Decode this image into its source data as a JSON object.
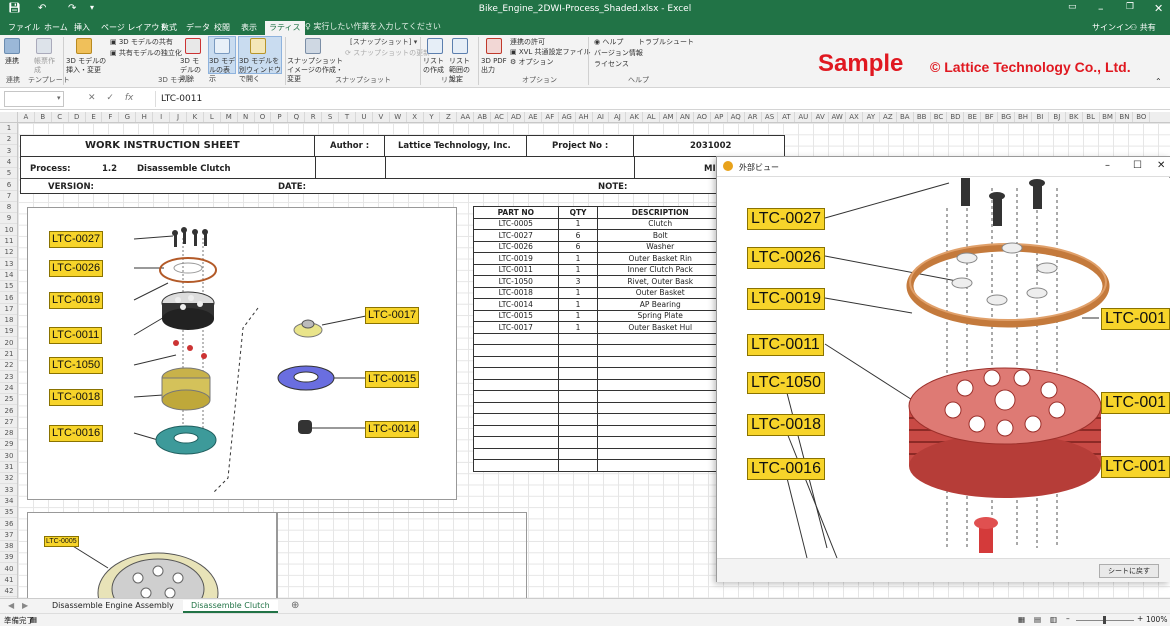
{
  "window": {
    "title": "Bike_Engine_2DWI-Process_Shaded.xlsx - Excel",
    "signin": "サインイン",
    "share": "共有"
  },
  "ribbon_tabs": [
    "ファイル",
    "ホーム",
    "挿入",
    "ページ レイアウト",
    "数式",
    "データ",
    "校閲",
    "表示",
    "ラティス"
  ],
  "tell_me": "実行したい作業を入力してください",
  "ribbon": {
    "g1": {
      "b1": "連携",
      "b2": "帳票作成",
      "label": "連携",
      "label2": "テンプレート"
    },
    "g2": {
      "b1": "3D モデルの挿入・変更",
      "b2": "3D モデルの共有",
      "b3": "共有モデルの独立化",
      "b4": "3D モデルの削除",
      "b5": "3D モデルの表示",
      "b6": "3D モデルを別ウィンドウで開く",
      "label": "3D モデル"
    },
    "g3": {
      "b1": "スナップショットイメージの作成・変更",
      "b2": "[スナップショット]",
      "b3": "スナップショットの更新",
      "label": "スナップショット"
    },
    "g4": {
      "b1": "リストの作成",
      "b2": "リスト範囲の設定",
      "label": "リスト"
    },
    "g5": {
      "b1": "3D PDF 出力",
      "b2": "連携の許可",
      "b3": "XVL 共通設定ファイル",
      "b4": "オプション",
      "label": "オプション"
    },
    "g6": {
      "b1": "ヘルプ",
      "b2": "トラブルシュート",
      "b3": "バージョン情報",
      "b4": "ライセンス",
      "label": "ヘルプ"
    }
  },
  "watermark": {
    "sample": "Sample",
    "copyright": "© Lattice Technology Co., Ltd."
  },
  "formula": {
    "namebox": "",
    "value": "LTC-0011",
    "fx": "fx"
  },
  "columns": [
    "A",
    "B",
    "C",
    "D",
    "E",
    "F",
    "G",
    "H",
    "I",
    "J",
    "K",
    "L",
    "M",
    "N",
    "O",
    "P",
    "Q",
    "R",
    "S",
    "T",
    "U",
    "V",
    "W",
    "X",
    "Y",
    "Z",
    "AA",
    "AB",
    "AC",
    "AD",
    "AE",
    "AF",
    "AG",
    "AH",
    "AI",
    "AJ",
    "AK",
    "AL",
    "AM",
    "AN",
    "AO",
    "AP",
    "AQ",
    "AR",
    "AS",
    "AT",
    "AU",
    "AV",
    "AW",
    "AX",
    "AY",
    "AZ",
    "BA",
    "BB",
    "BC",
    "BD",
    "BE",
    "BF",
    "BG",
    "BH",
    "BI",
    "BJ",
    "BK",
    "BL",
    "BM",
    "BN",
    "BO"
  ],
  "rows": [
    "1",
    "2",
    "3",
    "4",
    "5",
    "6",
    "7",
    "8",
    "9",
    "10",
    "11",
    "12",
    "13",
    "14",
    "15",
    "16",
    "17",
    "18",
    "19",
    "20",
    "21",
    "22",
    "23",
    "24",
    "25",
    "26",
    "27",
    "28",
    "29",
    "30",
    "31",
    "32",
    "33",
    "34",
    "35",
    "36",
    "37",
    "38",
    "39",
    "40",
    "41",
    "42"
  ],
  "form": {
    "title": "WORK INSTRUCTION SHEET",
    "author_label": "Author :",
    "author": "Lattice Technology, Inc.",
    "project_label": "Project No :",
    "project": "2031002",
    "process_label": "Process:",
    "process_no": "1.2",
    "process_name": "Disassemble Clutch",
    "mi": "MI",
    "version_label": "VERSION:",
    "date_label": "DATE:",
    "note_label": "NOTE:"
  },
  "callouts_left": [
    "LTC-0027",
    "LTC-0026",
    "LTC-0019",
    "LTC-0011",
    "LTC-1050",
    "LTC-0018",
    "LTC-0016"
  ],
  "callouts_right": [
    "LTC-0017",
    "LTC-0015",
    "LTC-0014"
  ],
  "callout_bottom": "LTC-0005",
  "parts_table": {
    "headers": [
      "PART NO",
      "QTY",
      "DESCRIPTION"
    ],
    "rows": [
      [
        "LTC-0005",
        "1",
        "Clutch"
      ],
      [
        "LTC-0027",
        "6",
        "Bolt"
      ],
      [
        "LTC-0026",
        "6",
        "Washer"
      ],
      [
        "LTC-0019",
        "1",
        "Outer Basket Rin"
      ],
      [
        "LTC-0011",
        "1",
        "Inner Clutch Pack"
      ],
      [
        "LTC-1050",
        "3",
        "Rivet, Outer Bask"
      ],
      [
        "LTC-0018",
        "1",
        "Outer Basket"
      ],
      [
        "LTC-0014",
        "1",
        "AP Bearing"
      ],
      [
        "LTC-0015",
        "1",
        "Spring Plate"
      ],
      [
        "LTC-0017",
        "1",
        "Outer Basket Hul"
      ]
    ]
  },
  "popup": {
    "title": "外部ビュー",
    "callouts": [
      "LTC-0027",
      "LTC-0026",
      "LTC-0019",
      "LTC-0011",
      "LTC-1050",
      "LTC-0018",
      "LTC-0016"
    ],
    "callouts_right": [
      "LTC-001",
      "LTC-001",
      "LTC-001"
    ],
    "return_button": "シートに戻す"
  },
  "sheet_tabs": [
    "Disassemble Engine Assembly",
    "Disassemble Clutch"
  ],
  "status": {
    "ready": "準備完了",
    "zoom": "100%"
  },
  "colors": {
    "excel_green": "#217346",
    "callout_yellow": "#f7d42a",
    "part_red": "#d9605c",
    "accent_red": "#e01820"
  }
}
